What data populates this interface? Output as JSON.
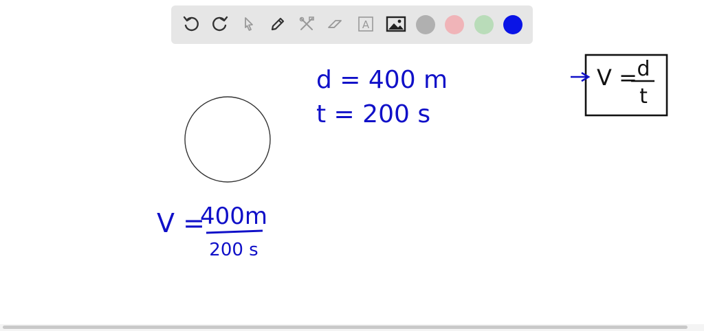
{
  "toolbar": {
    "tools": [
      {
        "name": "undo-icon"
      },
      {
        "name": "redo-icon"
      },
      {
        "name": "select-pointer-icon"
      },
      {
        "name": "pen-icon"
      },
      {
        "name": "tools-icon"
      },
      {
        "name": "eraser-icon"
      },
      {
        "name": "text-box-icon"
      },
      {
        "name": "image-icon"
      }
    ],
    "colors": [
      "#b0b0b0",
      "#f0b4b8",
      "#b9dcb9",
      "#0a14e6"
    ],
    "text_tool_label": "A"
  },
  "canvas": {
    "given_d": "d = 400 m",
    "given_t": "t = 200 s",
    "formula_v": "V =",
    "formula_num": "d",
    "formula_den": "t",
    "work_v": "V =",
    "work_num": "400m",
    "work_den": "200 s"
  }
}
